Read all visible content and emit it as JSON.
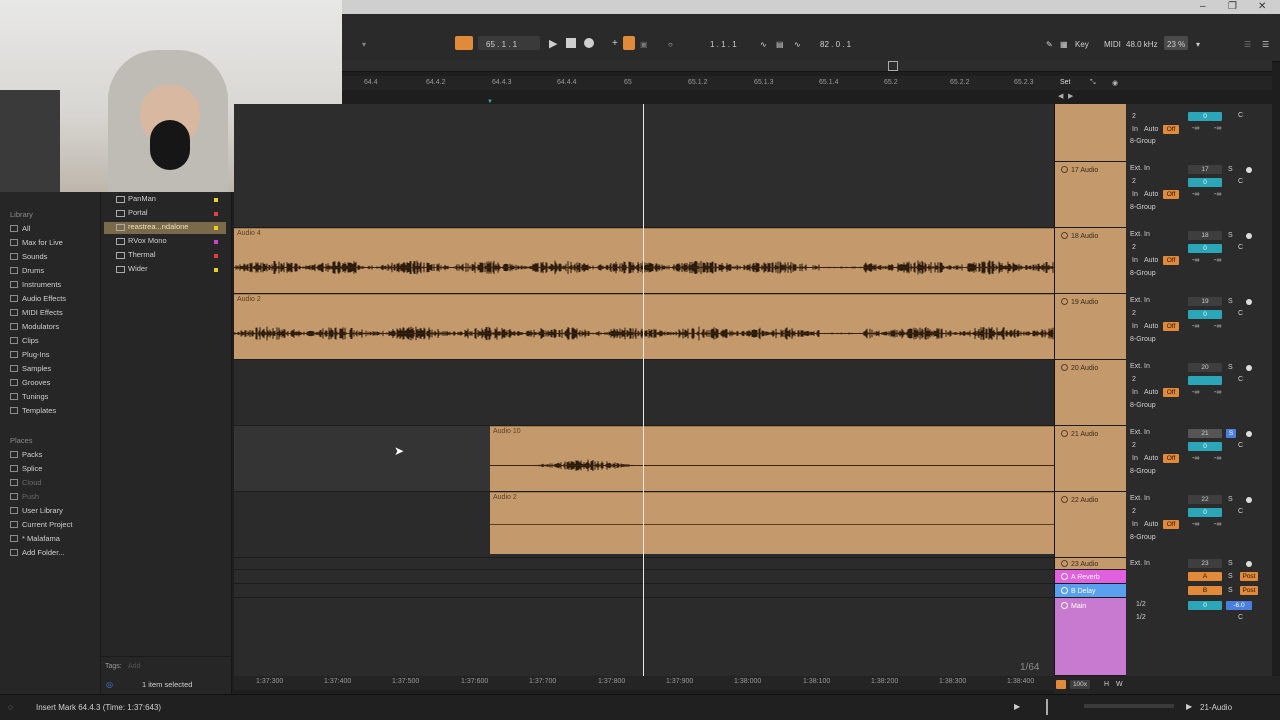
{
  "transport": {
    "position": "65 . 1 . 1",
    "loop_start": "1 . 1 . 1",
    "loop_length": "82 . 0 . 1",
    "key_label": "Key",
    "midi_label": "MIDI",
    "sample_rate": "48.0 kHz",
    "cpu": "23 %"
  },
  "ruler": {
    "bars": [
      "64.4",
      "64.4.2",
      "64.4.3",
      "64.4.4",
      "65",
      "65.1.2",
      "65.1.3",
      "65.1.4",
      "65.2",
      "65.2.2",
      "65.2.3"
    ],
    "set_label": "Set"
  },
  "timeline": {
    "ticks": [
      "1:37:300",
      "1:37:400",
      "1:37:500",
      "1:37:600",
      "1:37:700",
      "1:37:800",
      "1:37:900",
      "1:38:000",
      "1:38:100",
      "1:38:200",
      "1:38:300",
      "1:38:400"
    ],
    "grid": "1/64"
  },
  "browser": {
    "library_header": "Library",
    "categories": [
      "All",
      "Max for Live",
      "Sounds",
      "Drums",
      "Instruments",
      "Audio Effects",
      "MIDI Effects",
      "Modulators",
      "Clips",
      "Plug-Ins",
      "Samples",
      "Grooves",
      "Tunings",
      "Templates"
    ],
    "places_header": "Places",
    "places": [
      "Packs",
      "Splice",
      "Cloud",
      "Push",
      "User Library",
      "Current Project",
      "* Malafama",
      "Add Folder..."
    ],
    "files": [
      {
        "name": "PanMan",
        "color": "#e8d020"
      },
      {
        "name": "Portal",
        "color": "#e84040"
      },
      {
        "name": "reastrea...ndalone",
        "color": "#e8d020"
      },
      {
        "name": "RVox Mono",
        "color": "#d040d0"
      },
      {
        "name": "Thermal",
        "color": "#e84040"
      },
      {
        "name": "Wider",
        "color": "#e8d020"
      }
    ],
    "tags_label": "Tags:",
    "tags_placeholder": "Add",
    "selection": "1 item selected"
  },
  "clips": [
    {
      "name": "Audio 4"
    },
    {
      "name": "Audio 2"
    },
    {
      "name": "Audio 10"
    },
    {
      "name": "Audio 2"
    }
  ],
  "tracks": [
    {
      "name": "17 Audio",
      "number": "17"
    },
    {
      "name": "18 Audio",
      "number": "18"
    },
    {
      "name": "19 Audio",
      "number": "19"
    },
    {
      "name": "20 Audio",
      "number": "20"
    },
    {
      "name": "21 Audio",
      "number": "21"
    },
    {
      "name": "22 Audio",
      "number": "22"
    },
    {
      "name": "23 Audio",
      "number": "23"
    }
  ],
  "routing": {
    "input": "Ext. In",
    "channel": "2",
    "monitor_in": "In",
    "monitor_auto": "Auto",
    "monitor_off": "Off",
    "output": "8-Group",
    "volume": "0",
    "pan": "C",
    "send_off": "-∞",
    "solo": "S"
  },
  "returns": [
    {
      "name": "A Reverb",
      "letter": "A",
      "color": "#e060e0"
    },
    {
      "name": "B Delay",
      "letter": "B",
      "color": "#5aa0f0"
    }
  ],
  "main": {
    "name": "Main",
    "out1": "1/2",
    "out2": "1/2",
    "volume": "0",
    "meter": "-6.0",
    "post": "Post"
  },
  "status": {
    "message": "Insert Mark 64.4.3 (Time: 1:37:643)",
    "selected_track": "21-Audio",
    "zoom": "100x"
  }
}
